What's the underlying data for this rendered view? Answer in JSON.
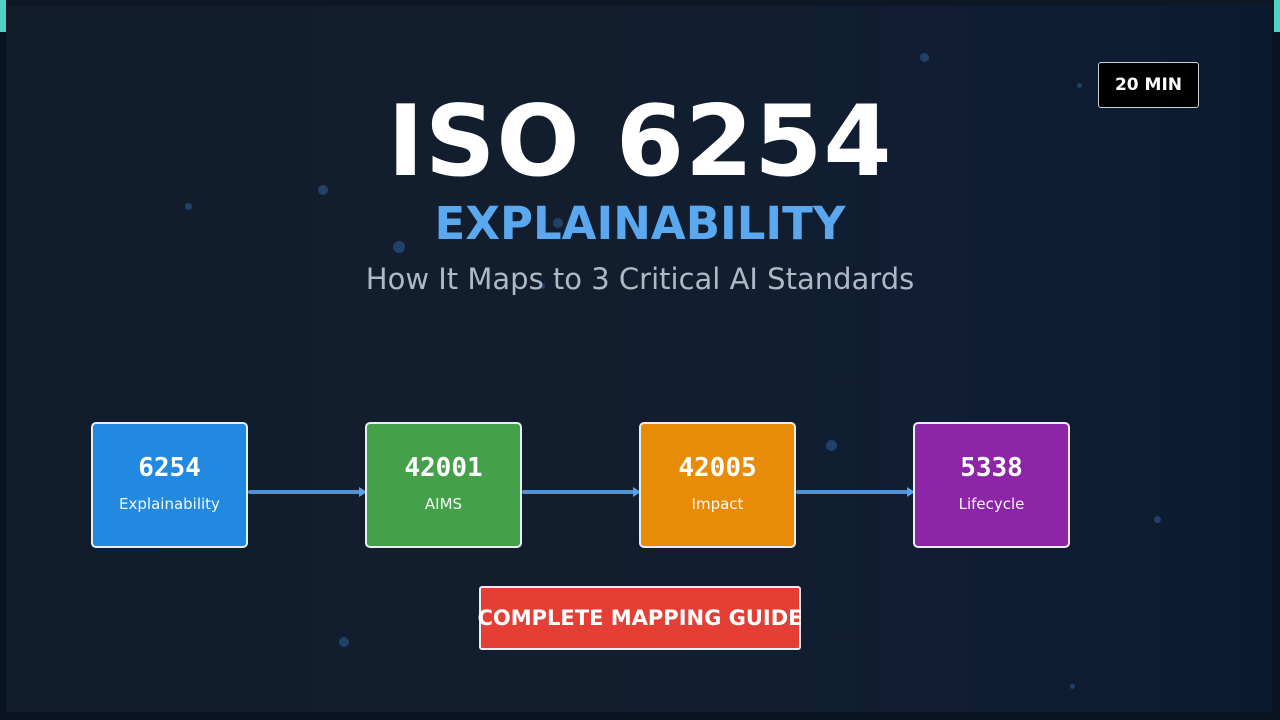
{
  "header": {
    "title": "ISO 6254",
    "subtitle": "EXPLAINABILITY",
    "tagline": "How It Maps to 3 Critical AI Standards"
  },
  "badge": {
    "label": "20 MIN"
  },
  "standards": [
    {
      "number": "6254",
      "label": "Explainability",
      "color": "#2189e0"
    },
    {
      "number": "42001",
      "label": "AIMS",
      "color": "#45a04a"
    },
    {
      "number": "42005",
      "label": "Impact",
      "color": "#e88c08"
    },
    {
      "number": "5338",
      "label": "Lifecycle",
      "color": "#8c26a6"
    }
  ],
  "cta": {
    "label": "COMPLETE MAPPING GUIDE",
    "color": "#e53f35"
  },
  "theme": {
    "accent": "#5aa9f0",
    "corner_accent": "#4fd1c5",
    "connector": "#5aa0e6"
  }
}
